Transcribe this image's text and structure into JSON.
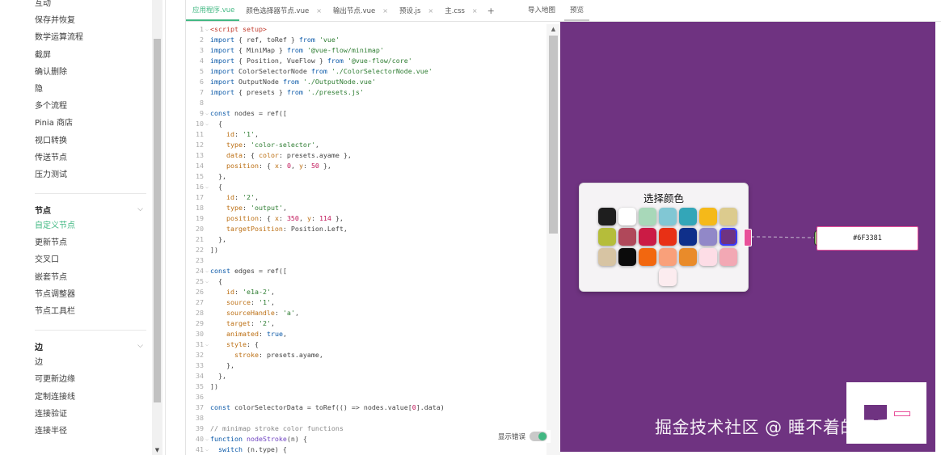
{
  "sidebar": {
    "top_items": [
      {
        "label": "互动"
      },
      {
        "label": "保存并恢复"
      },
      {
        "label": "数学运算流程"
      },
      {
        "label": "截屏"
      },
      {
        "label": "确认删除"
      },
      {
        "label": "隐"
      },
      {
        "label": "多个流程"
      },
      {
        "label": "Pinia 商店"
      },
      {
        "label": "视口转换"
      },
      {
        "label": "传送节点"
      },
      {
        "label": "压力测试"
      }
    ],
    "groups": [
      {
        "title": "节点",
        "items": [
          {
            "label": "自定义节点",
            "active": true
          },
          {
            "label": "更新节点"
          },
          {
            "label": "交叉口"
          },
          {
            "label": "嵌套节点"
          },
          {
            "label": "节点调整器"
          },
          {
            "label": "节点工具栏"
          }
        ]
      },
      {
        "title": "边",
        "items": [
          {
            "label": "边"
          },
          {
            "label": "可更新边缘"
          },
          {
            "label": "定制连接线"
          },
          {
            "label": "连接验证"
          },
          {
            "label": "连接半径"
          }
        ]
      }
    ],
    "chevron": "chevron-down-icon"
  },
  "editor": {
    "tabs": [
      {
        "label": "应用程序.vue",
        "active": true,
        "closable": false
      },
      {
        "label": "颜色选择器节点.vue",
        "closable": true
      },
      {
        "label": "输出节点.vue",
        "closable": true
      },
      {
        "label": "预设.js",
        "closable": true
      },
      {
        "label": "主.css",
        "closable": true
      }
    ],
    "add_tab": "+",
    "close_glyph": "×",
    "import_map": "导入地图",
    "show_errors_label": "显示错误",
    "show_errors_on": true,
    "code_lines": [
      {
        "n": "1",
        "fold": true,
        "tokens": [
          [
            "tag",
            "<script setup>"
          ]
        ]
      },
      {
        "n": "2",
        "tokens": [
          [
            "kw",
            "import"
          ],
          [
            "",
            " { ref, toRef } "
          ],
          [
            "kw",
            "from"
          ],
          [
            "",
            " "
          ],
          [
            "str",
            "'vue'"
          ]
        ]
      },
      {
        "n": "3",
        "tokens": [
          [
            "kw",
            "import"
          ],
          [
            "",
            " { MiniMap } "
          ],
          [
            "kw",
            "from"
          ],
          [
            "",
            " "
          ],
          [
            "str",
            "'@vue-flow/minimap'"
          ]
        ]
      },
      {
        "n": "4",
        "tokens": [
          [
            "kw",
            "import"
          ],
          [
            "",
            " { Position, VueFlow } "
          ],
          [
            "kw",
            "from"
          ],
          [
            "",
            " "
          ],
          [
            "str",
            "'@vue-flow/core'"
          ]
        ]
      },
      {
        "n": "5",
        "tokens": [
          [
            "kw",
            "import"
          ],
          [
            "",
            " ColorSelectorNode "
          ],
          [
            "kw",
            "from"
          ],
          [
            "",
            " "
          ],
          [
            "str",
            "'./ColorSelectorNode.vue'"
          ]
        ]
      },
      {
        "n": "6",
        "tokens": [
          [
            "kw",
            "import"
          ],
          [
            "",
            " OutputNode "
          ],
          [
            "kw",
            "from"
          ],
          [
            "",
            " "
          ],
          [
            "str",
            "'./OutputNode.vue'"
          ]
        ]
      },
      {
        "n": "7",
        "tokens": [
          [
            "kw",
            "import"
          ],
          [
            "",
            " { presets } "
          ],
          [
            "kw",
            "from"
          ],
          [
            "",
            " "
          ],
          [
            "str",
            "'./presets.js'"
          ]
        ]
      },
      {
        "n": "8",
        "tokens": []
      },
      {
        "n": "9",
        "fold": true,
        "tokens": [
          [
            "kw",
            "const"
          ],
          [
            "",
            " nodes = ref(["
          ]
        ]
      },
      {
        "n": "10",
        "fold": true,
        "tokens": [
          [
            "",
            "  {"
          ]
        ]
      },
      {
        "n": "11",
        "tokens": [
          [
            "prop",
            "    id"
          ],
          [
            "",
            ": "
          ],
          [
            "str",
            "'1'"
          ],
          [
            "",
            ","
          ]
        ]
      },
      {
        "n": "12",
        "tokens": [
          [
            "prop",
            "    type"
          ],
          [
            "",
            ": "
          ],
          [
            "str",
            "'color-selector'"
          ],
          [
            "",
            ","
          ]
        ]
      },
      {
        "n": "13",
        "tokens": [
          [
            "prop",
            "    data"
          ],
          [
            "",
            ": { "
          ],
          [
            "prop",
            "color"
          ],
          [
            "",
            ": presets.ayame },"
          ]
        ]
      },
      {
        "n": "14",
        "tokens": [
          [
            "prop",
            "    position"
          ],
          [
            "",
            ": { "
          ],
          [
            "prop",
            "x"
          ],
          [
            "",
            ": "
          ],
          [
            "num",
            "0"
          ],
          [
            "",
            ", "
          ],
          [
            "prop",
            "y"
          ],
          [
            "",
            ": "
          ],
          [
            "num",
            "50"
          ],
          [
            "",
            " },"
          ]
        ]
      },
      {
        "n": "15",
        "tokens": [
          [
            "",
            "  },"
          ]
        ]
      },
      {
        "n": "16",
        "fold": true,
        "tokens": [
          [
            "",
            "  {"
          ]
        ]
      },
      {
        "n": "17",
        "tokens": [
          [
            "prop",
            "    id"
          ],
          [
            "",
            ": "
          ],
          [
            "str",
            "'2'"
          ],
          [
            "",
            ","
          ]
        ]
      },
      {
        "n": "18",
        "tokens": [
          [
            "prop",
            "    type"
          ],
          [
            "",
            ": "
          ],
          [
            "str",
            "'output'"
          ],
          [
            "",
            ","
          ]
        ]
      },
      {
        "n": "19",
        "tokens": [
          [
            "prop",
            "    position"
          ],
          [
            "",
            ": { "
          ],
          [
            "prop",
            "x"
          ],
          [
            "",
            ": "
          ],
          [
            "num",
            "350"
          ],
          [
            "",
            ", "
          ],
          [
            "prop",
            "y"
          ],
          [
            "",
            ": "
          ],
          [
            "num",
            "114"
          ],
          [
            "",
            " },"
          ]
        ]
      },
      {
        "n": "20",
        "tokens": [
          [
            "prop",
            "    targetPosition"
          ],
          [
            "",
            ": Position.Left,"
          ]
        ]
      },
      {
        "n": "21",
        "tokens": [
          [
            "",
            "  },"
          ]
        ]
      },
      {
        "n": "22",
        "tokens": [
          [
            "",
            "])"
          ]
        ]
      },
      {
        "n": "23",
        "tokens": []
      },
      {
        "n": "24",
        "fold": true,
        "tokens": [
          [
            "kw",
            "const"
          ],
          [
            "",
            " edges = ref(["
          ]
        ]
      },
      {
        "n": "25",
        "fold": true,
        "tokens": [
          [
            "",
            "  {"
          ]
        ]
      },
      {
        "n": "26",
        "tokens": [
          [
            "prop",
            "    id"
          ],
          [
            "",
            ": "
          ],
          [
            "str",
            "'e1a-2'"
          ],
          [
            "",
            ","
          ]
        ]
      },
      {
        "n": "27",
        "tokens": [
          [
            "prop",
            "    source"
          ],
          [
            "",
            ": "
          ],
          [
            "str",
            "'1'"
          ],
          [
            "",
            ","
          ]
        ]
      },
      {
        "n": "28",
        "tokens": [
          [
            "prop",
            "    sourceHandle"
          ],
          [
            "",
            ": "
          ],
          [
            "str",
            "'a'"
          ],
          [
            "",
            ","
          ]
        ]
      },
      {
        "n": "29",
        "tokens": [
          [
            "prop",
            "    target"
          ],
          [
            "",
            ": "
          ],
          [
            "str",
            "'2'"
          ],
          [
            "",
            ","
          ]
        ]
      },
      {
        "n": "30",
        "tokens": [
          [
            "prop",
            "    animated"
          ],
          [
            "",
            ": "
          ],
          [
            "kw",
            "true"
          ],
          [
            "",
            ","
          ]
        ]
      },
      {
        "n": "31",
        "fold": true,
        "tokens": [
          [
            "prop",
            "    style"
          ],
          [
            "",
            ": {"
          ]
        ]
      },
      {
        "n": "32",
        "tokens": [
          [
            "prop",
            "      stroke"
          ],
          [
            "",
            ": presets.ayame,"
          ]
        ]
      },
      {
        "n": "33",
        "tokens": [
          [
            "",
            "    },"
          ]
        ]
      },
      {
        "n": "34",
        "tokens": [
          [
            "",
            "  },"
          ]
        ]
      },
      {
        "n": "35",
        "tokens": [
          [
            "",
            "])"
          ]
        ]
      },
      {
        "n": "36",
        "tokens": []
      },
      {
        "n": "37",
        "tokens": [
          [
            "kw",
            "const"
          ],
          [
            "",
            " colorSelectorData = toRef(() => nodes.value["
          ],
          [
            "num",
            "0"
          ],
          [
            "",
            "].data)"
          ]
        ]
      },
      {
        "n": "38",
        "tokens": []
      },
      {
        "n": "39",
        "tokens": [
          [
            "comment",
            "// minimap stroke color functions"
          ]
        ]
      },
      {
        "n": "40",
        "fold": true,
        "tokens": [
          [
            "kw",
            "function"
          ],
          [
            "",
            " "
          ],
          [
            "fn",
            "nodeStroke"
          ],
          [
            "",
            "(n) {"
          ]
        ]
      },
      {
        "n": "41",
        "fold": true,
        "tokens": [
          [
            "kw",
            "  switch"
          ],
          [
            "",
            " (n.type) {"
          ]
        ]
      }
    ]
  },
  "preview": {
    "tab_label": "预览",
    "canvas_color": "#6F3381",
    "color_node": {
      "title": "选择颜色",
      "swatches": [
        "#1e1e1e",
        "#ffffff",
        "#a8d8b9",
        "#81c7d4",
        "#33a6b8",
        "#f5b919",
        "#dccb8e",
        "#b5bd3a",
        "#b0485a",
        "#cb1b45",
        "#e83015",
        "#0f2f8a",
        "#9188c8",
        "#6f3381",
        "#d7c4a3",
        "#0b0b0b",
        "#f2670f",
        "#f9a07a",
        "#e98b2a",
        "#fddde6",
        "#f2a8b4",
        "#fcecef"
      ],
      "selected_index": 13
    },
    "output_node": {
      "value": "#6F3381"
    },
    "accent_pink": "#e8509a"
  },
  "watermark": "掘金技术社区 @ 睡不着的可乐"
}
